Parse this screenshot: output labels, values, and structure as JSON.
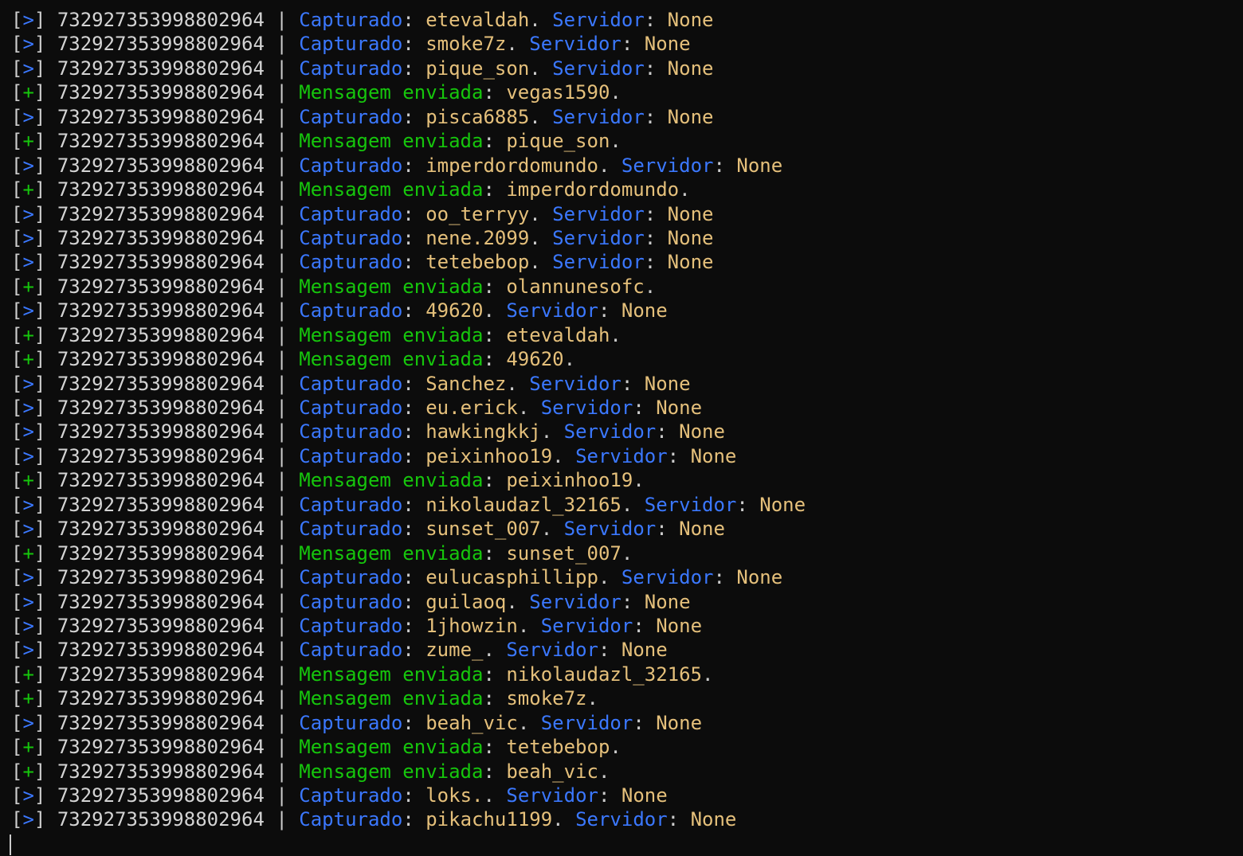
{
  "terminal": {
    "id": "732927353998802964",
    "labels": {
      "captured": "Capturado",
      "server": "Servidor",
      "sent": "Mensagem enviada",
      "none": "None"
    },
    "lines": [
      {
        "type": "capture",
        "user": "etevaldah"
      },
      {
        "type": "capture",
        "user": "smoke7z"
      },
      {
        "type": "capture",
        "user": "pique_son"
      },
      {
        "type": "sent",
        "user": "vegas1590"
      },
      {
        "type": "capture",
        "user": "pisca6885"
      },
      {
        "type": "sent",
        "user": "pique_son"
      },
      {
        "type": "capture",
        "user": "imperdordomundo"
      },
      {
        "type": "sent",
        "user": "imperdordomundo"
      },
      {
        "type": "capture",
        "user": "oo_terryy"
      },
      {
        "type": "capture",
        "user": "nene.2099"
      },
      {
        "type": "capture",
        "user": "tetebebop"
      },
      {
        "type": "sent",
        "user": "olannunesofc"
      },
      {
        "type": "capture",
        "user": "49620"
      },
      {
        "type": "sent",
        "user": "etevaldah"
      },
      {
        "type": "sent",
        "user": "49620"
      },
      {
        "type": "capture",
        "user": "Sanchez"
      },
      {
        "type": "capture",
        "user": "eu.erick"
      },
      {
        "type": "capture",
        "user": "hawkingkkj"
      },
      {
        "type": "capture",
        "user": "peixinhoo19"
      },
      {
        "type": "sent",
        "user": "peixinhoo19"
      },
      {
        "type": "capture",
        "user": "nikolaudazl_32165"
      },
      {
        "type": "capture",
        "user": "sunset_007"
      },
      {
        "type": "sent",
        "user": "sunset_007"
      },
      {
        "type": "capture",
        "user": "eulucasphillipp"
      },
      {
        "type": "capture",
        "user": "guilaoq"
      },
      {
        "type": "capture",
        "user": "1jhowzin"
      },
      {
        "type": "capture",
        "user": "zume_"
      },
      {
        "type": "sent",
        "user": "nikolaudazl_32165"
      },
      {
        "type": "sent",
        "user": "smoke7z"
      },
      {
        "type": "capture",
        "user": "beah_vic"
      },
      {
        "type": "sent",
        "user": "tetebebop"
      },
      {
        "type": "sent",
        "user": "beah_vic"
      },
      {
        "type": "capture",
        "user": "loks."
      },
      {
        "type": "capture",
        "user": "pikachu1199"
      }
    ]
  },
  "colors": {
    "background": "#0c0c0c",
    "blue": "#3b78ff",
    "green": "#16c60c",
    "yellow": "#e5c07b",
    "text": "#cccccc"
  }
}
